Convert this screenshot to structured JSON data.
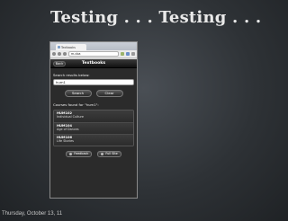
{
  "slide": {
    "title": "Testing . . . Testing . . .",
    "date": "Thursday, October 13, 11"
  },
  "browser": {
    "tab_title": "Textbooks",
    "url": "m.cba",
    "icons": [
      "back-icon",
      "forward-icon",
      "reload-icon",
      "star-icon",
      "extension-icon",
      "wrench-icon"
    ]
  },
  "app": {
    "back_label": "Back",
    "title": "Textbooks",
    "search_label": "Search results below:",
    "search_value": "hum1",
    "search_button": "Search",
    "clear_button": "Clear",
    "courses_label": "Courses found for \"hum1\":",
    "courses": [
      {
        "code": "HUM102",
        "name": "Individual Culture"
      },
      {
        "code": "HUM104",
        "name": "Age of Dances"
      },
      {
        "code": "HUM106",
        "name": "Life Stories"
      }
    ],
    "feedback_button": "Feedback",
    "full_site_button": "Full Site"
  }
}
